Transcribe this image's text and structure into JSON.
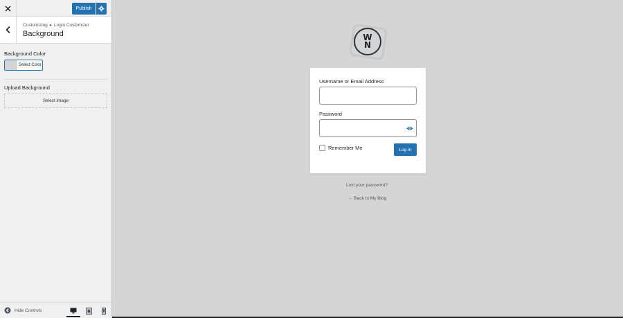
{
  "sidebar": {
    "close_label": "×",
    "publish_label": "Publish",
    "breadcrumb": [
      "Customizing",
      "Login Customizer"
    ],
    "breadcrumb_separator": "▸",
    "section_title": "Background",
    "background_color": {
      "label": "Background Color",
      "button_label": "Select Color",
      "current_color": "#d5d5d5"
    },
    "upload_background": {
      "label": "Upload Background",
      "button_label": "Select image"
    },
    "footer": {
      "hide_controls_label": "Hide Controls",
      "devices": [
        "desktop",
        "tablet",
        "mobile"
      ],
      "active_device": "desktop"
    }
  },
  "preview": {
    "logo_letters": [
      "W",
      "N"
    ],
    "login_form": {
      "username_label": "Username or Email Address",
      "username_value": "",
      "password_label": "Password",
      "password_value": "",
      "remember_label": "Remember Me",
      "remember_checked": false,
      "submit_label": "Log In"
    },
    "lost_password_link": "Lost your password?",
    "back_link": "← Back to My Blog"
  },
  "colors": {
    "accent": "#2271b1",
    "preview_background": "#d5d5d5",
    "sidebar_background": "#f0f0f1"
  }
}
